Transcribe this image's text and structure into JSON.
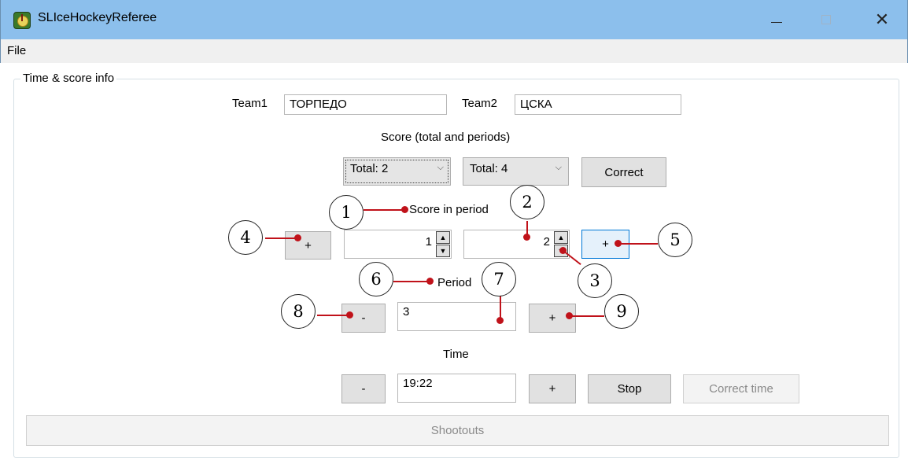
{
  "window": {
    "title": "SLIceHockeyReferee"
  },
  "menu": {
    "file": "File"
  },
  "group": {
    "label": "Time & score info"
  },
  "teams": {
    "team1_label": "Team1",
    "team1_value": "ТОРПЕДО",
    "team2_label": "Team2",
    "team2_value": "ЦСКА"
  },
  "score": {
    "heading": "Score (total and periods)",
    "team1_total": "Total: 2",
    "team2_total": "Total: 4",
    "correct_label": "Correct",
    "period_heading": "Score in period",
    "plus_left": "+",
    "team1_period": "1",
    "team2_period": "2",
    "plus_right": "+"
  },
  "period": {
    "heading": "Period",
    "minus": "-",
    "value": "3",
    "plus": "+"
  },
  "time": {
    "heading": "Time",
    "minus": "-",
    "value": "19:22",
    "plus": "+",
    "stop": "Stop",
    "correct_time": "Correct time"
  },
  "shootouts": "Shootouts",
  "callouts": [
    "1",
    "2",
    "3",
    "4",
    "5",
    "6",
    "7",
    "8",
    "9"
  ],
  "colors": {
    "titlebar": "#8cbfec",
    "callout_line": "#c0121a",
    "hot_button": "#e5f1fb"
  }
}
